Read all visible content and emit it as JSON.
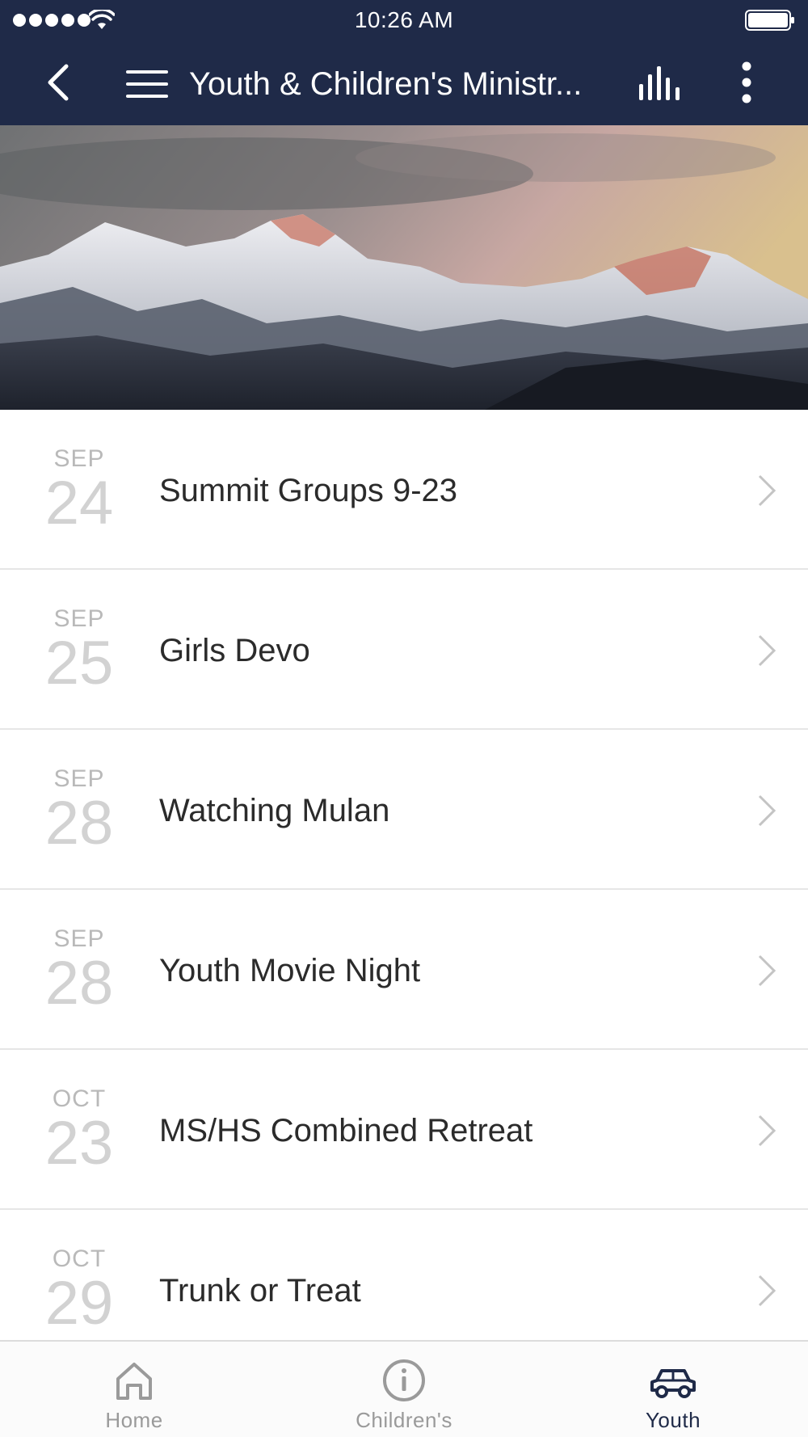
{
  "status_bar": {
    "time": "10:26 AM"
  },
  "nav": {
    "title": "Youth & Children's Ministr..."
  },
  "events": [
    {
      "month": "SEP",
      "day": "24",
      "title": "Summit Groups 9-23"
    },
    {
      "month": "SEP",
      "day": "25",
      "title": "Girls Devo"
    },
    {
      "month": "SEP",
      "day": "28",
      "title": "Watching Mulan"
    },
    {
      "month": "SEP",
      "day": "28",
      "title": "Youth Movie Night"
    },
    {
      "month": "OCT",
      "day": "23",
      "title": "MS/HS Combined Retreat"
    },
    {
      "month": "OCT",
      "day": "29",
      "title": "Trunk or Treat"
    }
  ],
  "tabs": [
    {
      "label": "Home",
      "icon": "home-icon",
      "active": false
    },
    {
      "label": "Children's",
      "icon": "info-icon",
      "active": false
    },
    {
      "label": "Youth",
      "icon": "car-icon",
      "active": true
    }
  ],
  "colors": {
    "nav_bg": "#1f2a48",
    "active_tab": "#1f2a48",
    "inactive_tab": "#9a9a9a"
  }
}
